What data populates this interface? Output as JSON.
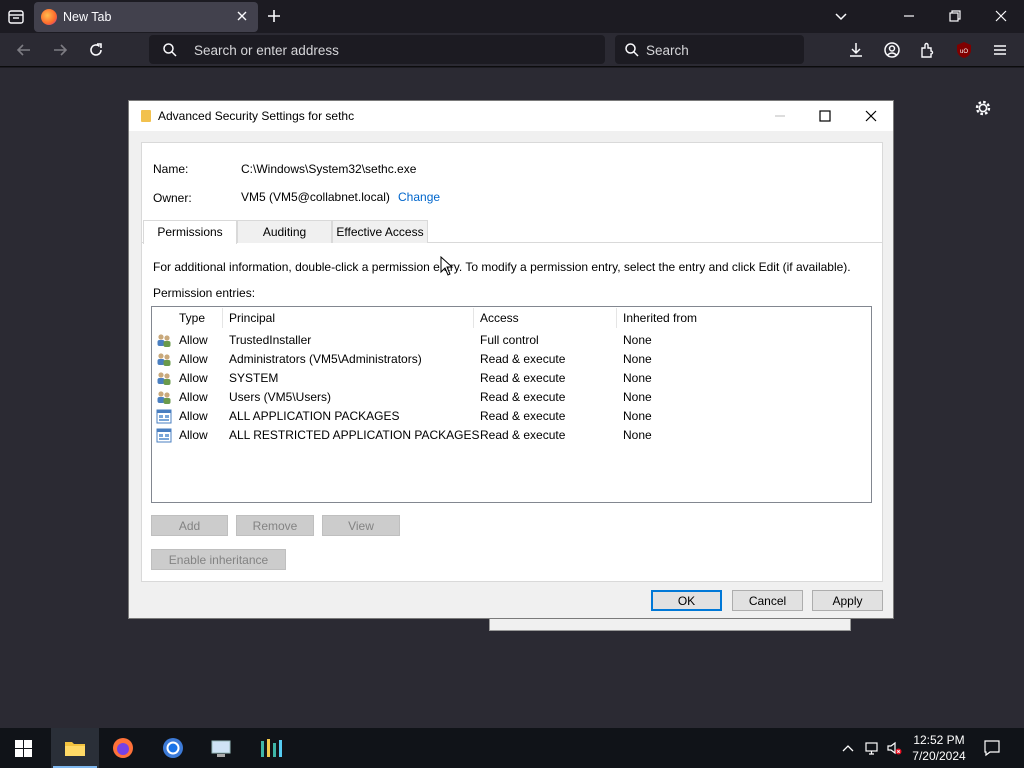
{
  "browser": {
    "tab_title": "New Tab",
    "url_placeholder": "Search or enter address",
    "search_placeholder": "Search"
  },
  "dialog": {
    "title": "Advanced Security Settings for sethc",
    "name_label": "Name:",
    "name_value": "C:\\Windows\\System32\\sethc.exe",
    "owner_label": "Owner:",
    "owner_value": "VM5 (VM5@collabnet.local)",
    "owner_change_link": "Change",
    "tabs": [
      "Permissions",
      "Auditing",
      "Effective Access"
    ],
    "info_text": "For additional information, double-click a permission entry. To modify a permission entry, select the entry and click Edit (if available).",
    "entries_label": "Permission entries:",
    "columns": [
      "Type",
      "Principal",
      "Access",
      "Inherited from"
    ],
    "entries": [
      {
        "type": "Allow",
        "principal": "TrustedInstaller",
        "access": "Full control",
        "inherited": "None",
        "icon": "users-icon"
      },
      {
        "type": "Allow",
        "principal": "Administrators (VM5\\Administrators)",
        "access": "Read & execute",
        "inherited": "None",
        "icon": "users-icon"
      },
      {
        "type": "Allow",
        "principal": "SYSTEM",
        "access": "Read & execute",
        "inherited": "None",
        "icon": "users-icon"
      },
      {
        "type": "Allow",
        "principal": "Users (VM5\\Users)",
        "access": "Read & execute",
        "inherited": "None",
        "icon": "users-icon"
      },
      {
        "type": "Allow",
        "principal": "ALL APPLICATION PACKAGES",
        "access": "Read & execute",
        "inherited": "None",
        "icon": "app-package-icon"
      },
      {
        "type": "Allow",
        "principal": "ALL RESTRICTED APPLICATION PACKAGES",
        "access": "Read & execute",
        "inherited": "None",
        "icon": "app-package-icon"
      }
    ],
    "buttons": {
      "add": "Add",
      "remove": "Remove",
      "view": "View",
      "enable_inheritance": "Enable inheritance",
      "ok": "OK",
      "cancel": "Cancel",
      "apply": "Apply"
    }
  },
  "taskbar": {
    "time": "12:52 PM",
    "date": "7/20/2024"
  },
  "colors": {
    "link": "#0066cc",
    "default_button_border": "#0078d7",
    "browser_bg": "#2b2a33",
    "taskbar_bg": "#101318"
  }
}
